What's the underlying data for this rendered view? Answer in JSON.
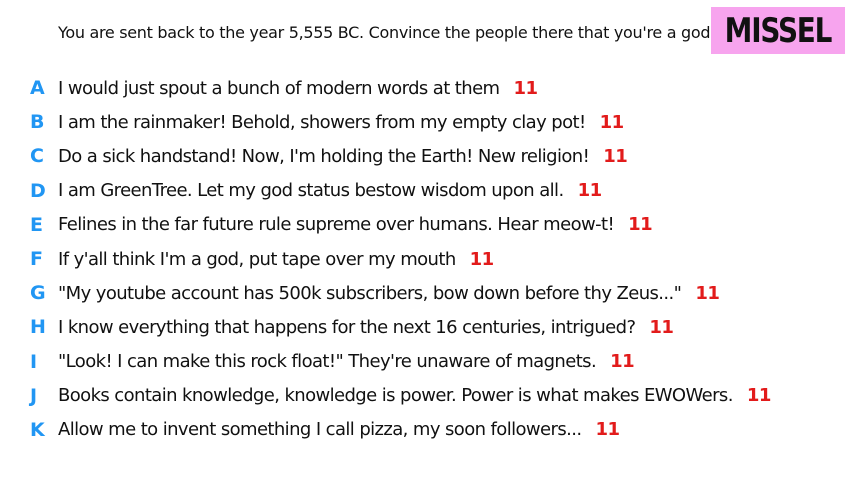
{
  "prompt": "You are sent back to the year 5,555 BC. Convince the people there that you're a god.",
  "badge": "MISSEL",
  "colors": {
    "letter": "#2196f3",
    "score": "#e21b1b",
    "badge_bg": "#f7a4ee",
    "text": "#111111"
  },
  "responses": [
    {
      "letter": "A",
      "text": "I would just spout a bunch of modern words at them",
      "score": "11"
    },
    {
      "letter": "B",
      "text": "I am the rainmaker! Behold, showers from my empty clay pot!",
      "score": "11"
    },
    {
      "letter": "C",
      "text": "Do a sick handstand! Now, I'm holding the Earth! New religion!",
      "score": "11"
    },
    {
      "letter": "D",
      "text": "I am GreenTree. Let my god status bestow wisdom upon all.",
      "score": "11"
    },
    {
      "letter": "E",
      "text": "Felines in the far future rule supreme over humans. Hear meow-t!",
      "score": "11"
    },
    {
      "letter": "F",
      "text": "If y'all think I'm a god, put tape over my mouth",
      "score": "11"
    },
    {
      "letter": "G",
      "text": "\"My youtube account has 500k subscribers, bow down before thy Zeus...\"",
      "score": "11"
    },
    {
      "letter": "H",
      "text": "I know everything that happens for the next 16 centuries, intrigued?",
      "score": "11"
    },
    {
      "letter": "I",
      "text": "\"Look! I can make this rock float!\" They're unaware of magnets.",
      "score": "11"
    },
    {
      "letter": "J",
      "text": "Books contain knowledge, knowledge is power. Power is what makes EWOWers.",
      "score": "11"
    },
    {
      "letter": "K",
      "text": "Allow me to invent something I call pizza, my soon followers...",
      "score": "11"
    }
  ]
}
